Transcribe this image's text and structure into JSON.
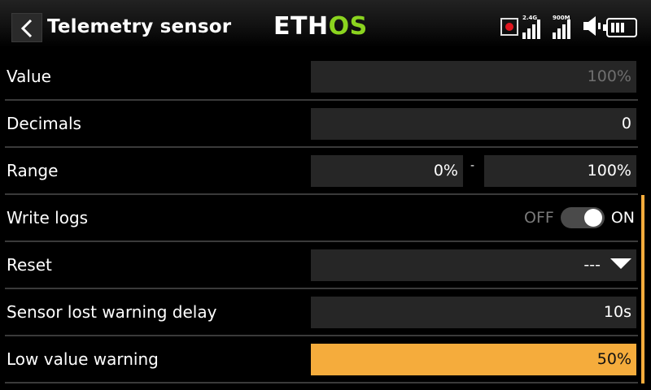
{
  "header": {
    "title": "Telemetry sensor",
    "logo_part1": "ETH",
    "logo_part2": "OS",
    "signal_2g4_label": "2.4G",
    "signal_900m_label": "900M"
  },
  "colors": {
    "accent": "#f5ac3c",
    "logo_green": "#8bd41f",
    "record": "#e0161f",
    "field_bg": "#262626"
  },
  "rows": [
    {
      "label": "Value",
      "value": "100%"
    },
    {
      "label": "Decimals",
      "value": "0"
    },
    {
      "label": "Range",
      "min": "0%",
      "separator": "-",
      "max": "100%"
    },
    {
      "label": "Write logs",
      "off_label": "OFF",
      "on_label": "ON",
      "state": "on"
    },
    {
      "label": "Reset",
      "value": "---"
    },
    {
      "label": "Sensor lost warning delay",
      "value": "10s"
    },
    {
      "label": "Low value warning",
      "value": "50%"
    }
  ]
}
